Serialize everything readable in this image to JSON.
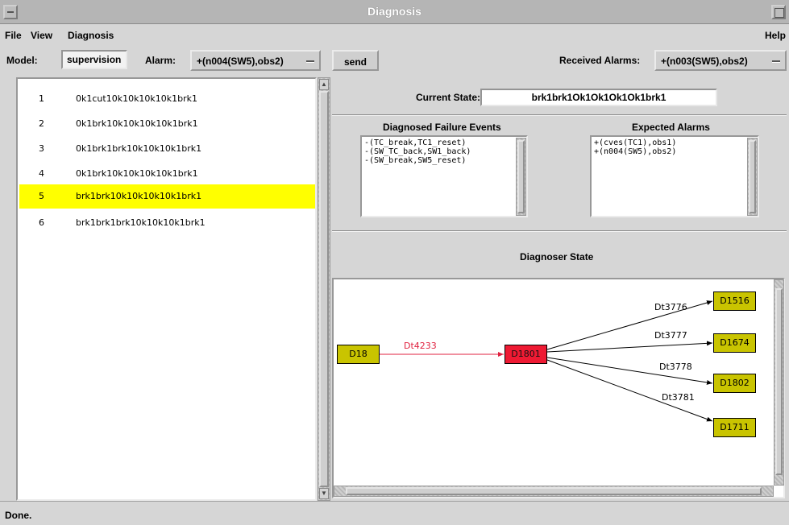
{
  "window": {
    "title": "Diagnosis"
  },
  "menu": {
    "file": "File",
    "view": "View",
    "diagnosis": "Diagnosis",
    "help": "Help"
  },
  "toolbar": {
    "model_label": "Model:",
    "model_value": "supervision",
    "alarm_label": "Alarm:",
    "alarm_value": "+(n004(SW5),obs2)",
    "send_label": "send",
    "received_label": "Received Alarms:",
    "received_value": "+(n003(SW5),obs2)"
  },
  "states": [
    {
      "index": "1",
      "text": "0k1cut10k10k10k10k1brk1",
      "selected": false
    },
    {
      "index": "2",
      "text": "0k1brk10k10k10k10k1brk1",
      "selected": false
    },
    {
      "index": "3",
      "text": "0k1brk1brk10k10k10k1brk1",
      "selected": false
    },
    {
      "index": "4",
      "text": "0k1brk10k10k10k10k1brk1",
      "selected": false
    },
    {
      "index": "5",
      "text": "brk1brk10k10k10k10k1brk1",
      "selected": true
    },
    {
      "index": "6",
      "text": "brk1brk1brk10k10k10k1brk1",
      "selected": false
    }
  ],
  "current_state": {
    "label": "Current State:",
    "value": "brk1brk1Ok1Ok1Ok1Ok1brk1"
  },
  "failure_events": {
    "title": "Diagnosed Failure Events",
    "items": [
      "-(TC_break,TC1_reset)",
      "-(SW_TC_back,SW1_back)",
      "-(SW_break,SW5_reset)"
    ]
  },
  "expected_alarms": {
    "title": "Expected Alarms",
    "items": [
      "+(cves(TC1),obs1)",
      "+(n004(SW5),obs2)"
    ]
  },
  "diagnoser": {
    "title": "Diagnoser State",
    "nodes": [
      {
        "id": "D18",
        "label": "D18",
        "color": "#c9c400"
      },
      {
        "id": "D1801",
        "label": "D1801",
        "color": "#ee1a33"
      },
      {
        "id": "D1516",
        "label": "D1516",
        "color": "#c9c400"
      },
      {
        "id": "D1674",
        "label": "D1674",
        "color": "#c9c400"
      },
      {
        "id": "D1802",
        "label": "D1802",
        "color": "#c9c400"
      },
      {
        "id": "D1711",
        "label": "D1711",
        "color": "#c9c400"
      }
    ],
    "edges": [
      {
        "label": "Dt4233",
        "from": "D18",
        "to": "D1801",
        "color": "#e0213f"
      },
      {
        "label": "Dt3776",
        "from": "D1801",
        "to": "D1516",
        "color": "#000000"
      },
      {
        "label": "Dt3777",
        "from": "D1801",
        "to": "D1674",
        "color": "#000000"
      },
      {
        "label": "Dt3778",
        "from": "D1801",
        "to": "D1802",
        "color": "#000000"
      },
      {
        "label": "Dt3781",
        "from": "D1801",
        "to": "D1711",
        "color": "#000000"
      }
    ]
  },
  "status": {
    "text": "Done."
  },
  "colors": {
    "selection": "#ffff00",
    "active_node": "#ee1a33",
    "node": "#c9c400"
  }
}
